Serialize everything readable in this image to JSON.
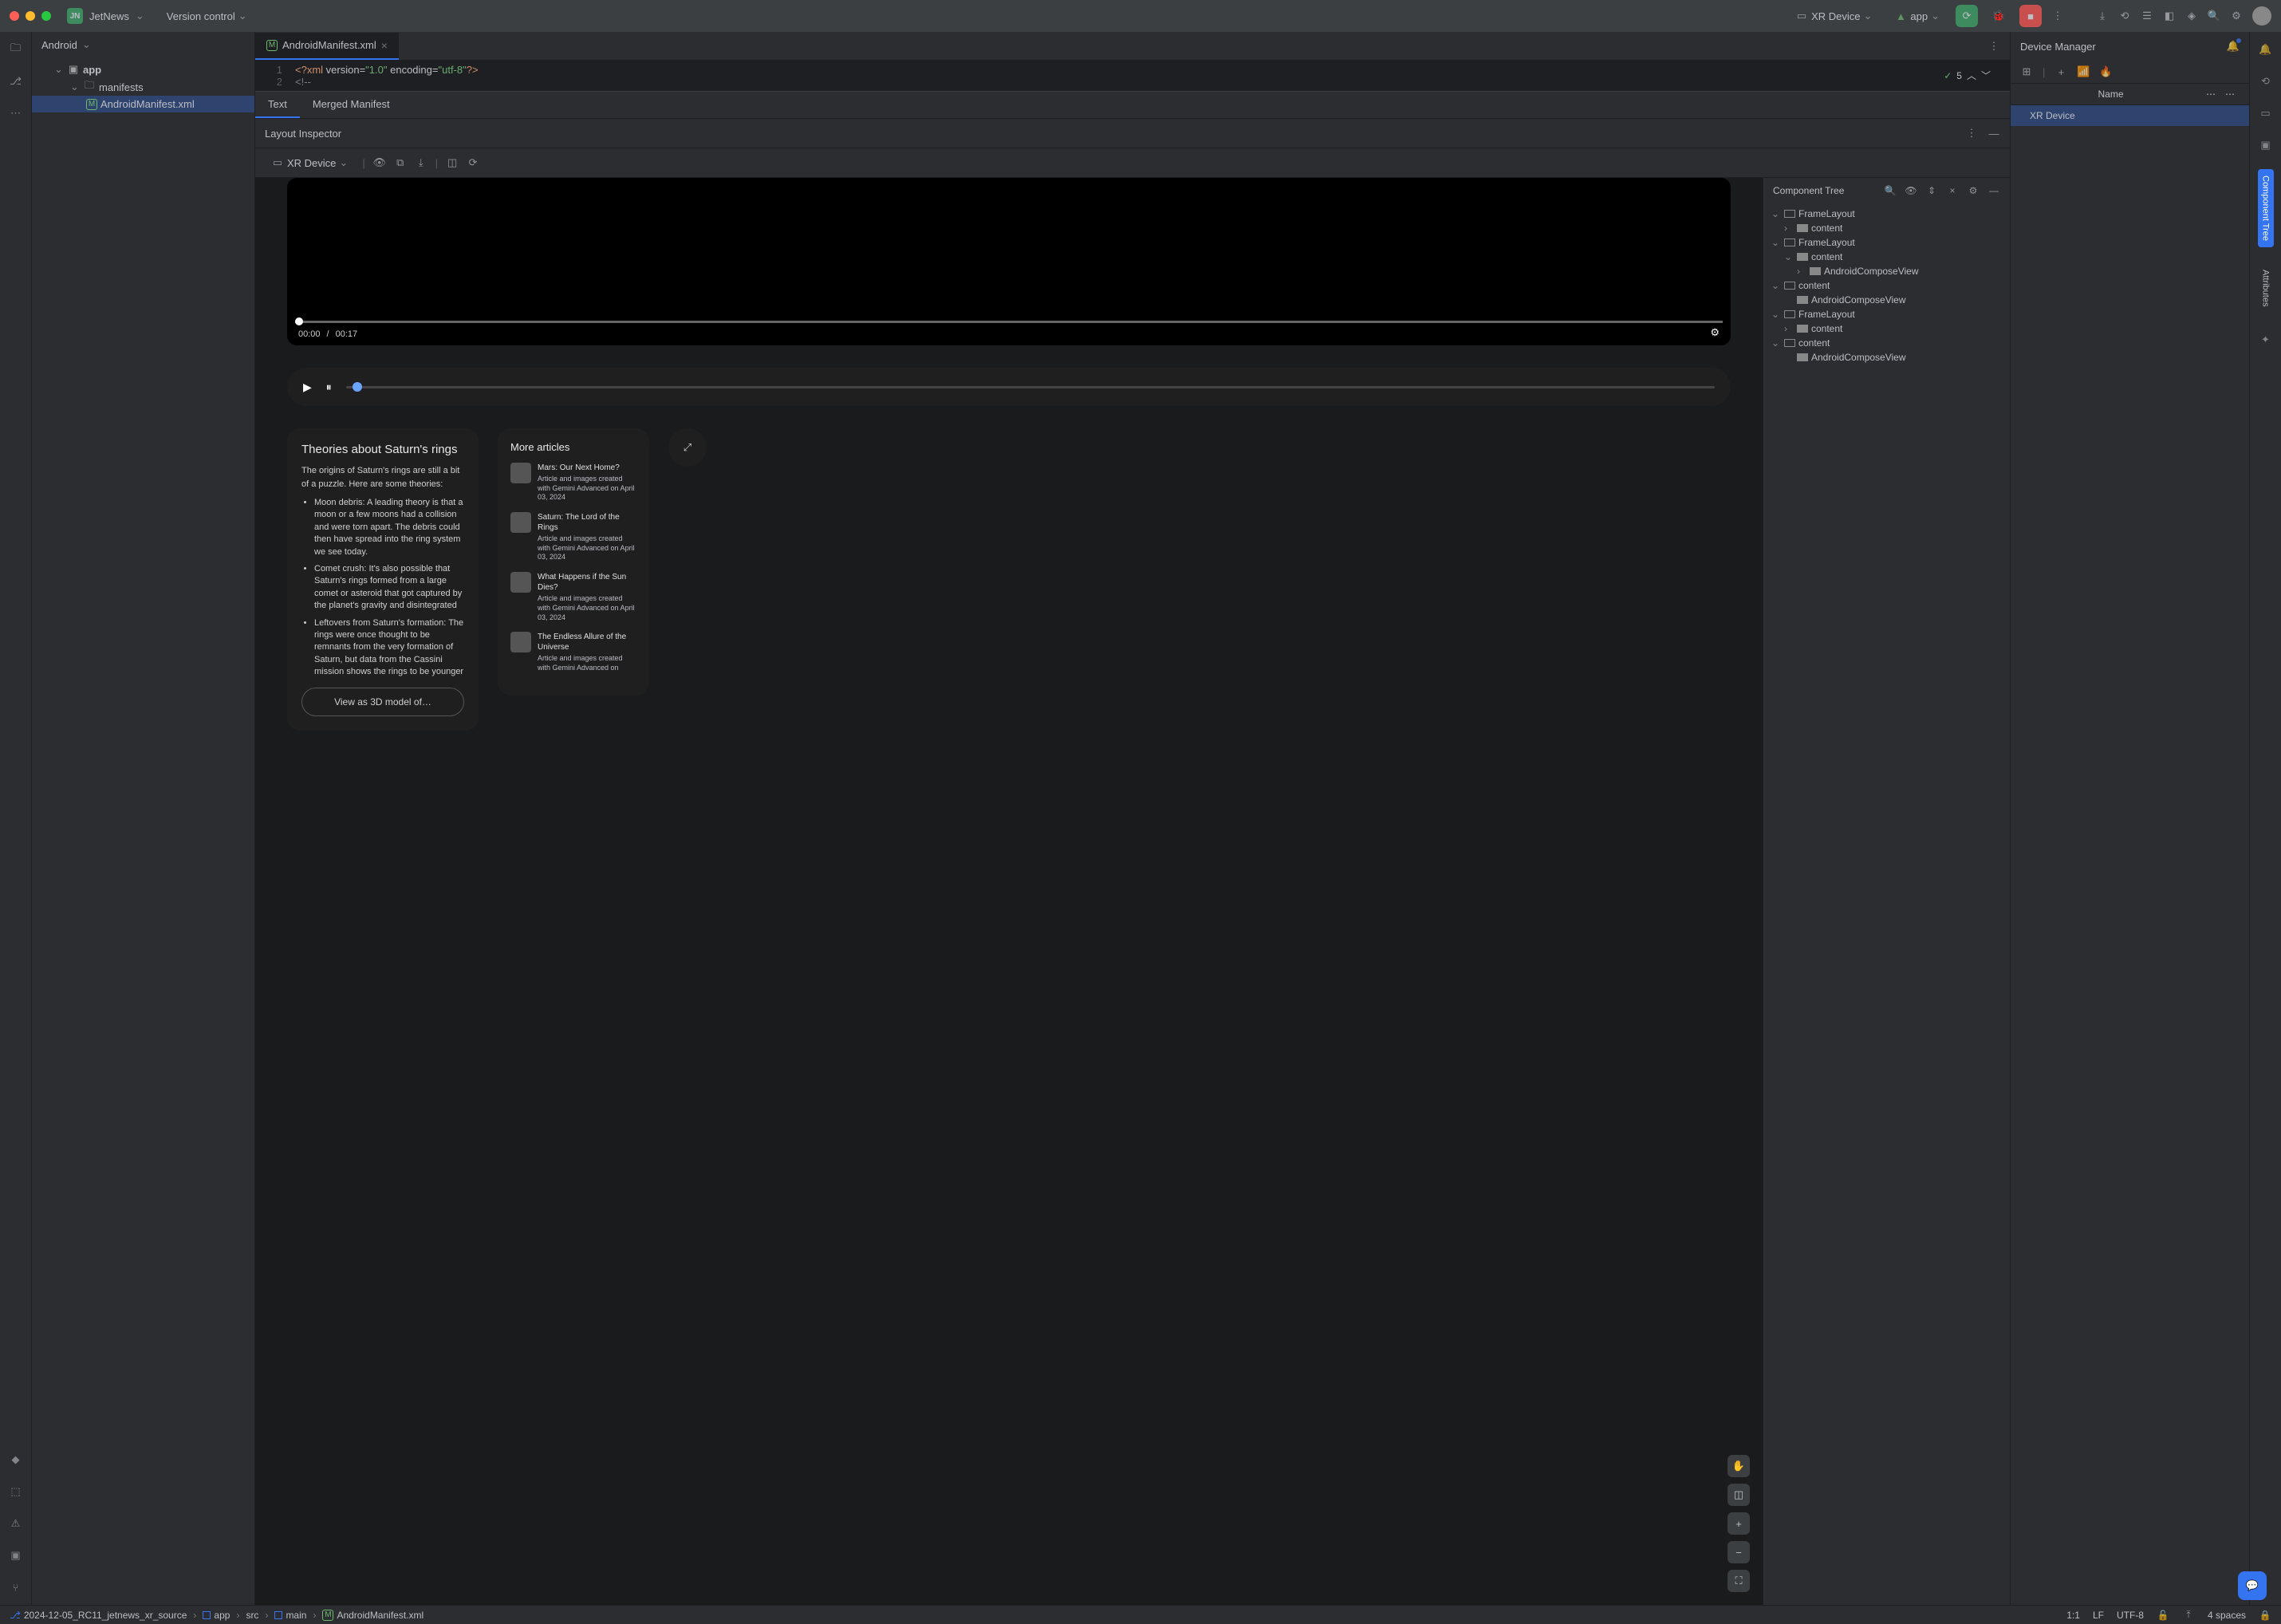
{
  "project": {
    "badge": "JN",
    "name": "JetNews"
  },
  "titlebar": {
    "vcs": "Version control",
    "deviceSelector": "XR Device",
    "runConfig": "app"
  },
  "projectPanel": {
    "title": "Android",
    "tree": {
      "app": "app",
      "manifests": "manifests",
      "manifestFile": "AndroidManifest.xml"
    }
  },
  "editor": {
    "tabFile": "AndroidManifest.xml",
    "line1": {
      "num": "1",
      "decl": "<?xml",
      "attr1": "version=",
      "val1": "\"1.0\"",
      "attr2": "encoding=",
      "val2": "\"utf-8\"",
      "close": "?>"
    },
    "line2": {
      "num": "2",
      "text": "<!--"
    },
    "problemsCount": "5",
    "subtabs": {
      "text": "Text",
      "merged": "Merged Manifest"
    }
  },
  "layoutInspector": {
    "title": "Layout Inspector",
    "deviceLabel": "XR Device"
  },
  "appContent": {
    "video": {
      "t0": "00:00",
      "sep": "/",
      "t1": "00:17"
    },
    "article": {
      "title": "Theories about Saturn's rings",
      "intro": "The origins of Saturn's rings are still a bit of a puzzle. Here are some theories:",
      "b1": "Moon debris: A leading theory is that a moon or a few moons had a collision and were torn apart. The debris could then have spread into the ring system we see today.",
      "b2": "Comet crush: It's also possible that Saturn's rings formed from a large comet or asteroid that got captured by the planet's gravity and disintegrated",
      "b3": "Leftovers from Saturn's formation: The rings were once thought to be remnants from the very formation of Saturn, but data from the Cassini mission shows the rings to be younger",
      "viewBtn": "View as 3D model of…"
    },
    "more": {
      "heading": "More articles",
      "items": [
        {
          "title": "Mars: Our Next Home?",
          "sub": "Article and images created with Gemini Advanced on April 03, 2024"
        },
        {
          "title": "Saturn: The Lord of the Rings",
          "sub": "Article and images created with Gemini Advanced on April 03, 2024"
        },
        {
          "title": "What Happens if the Sun Dies?",
          "sub": "Article and images created with Gemini Advanced on April 03, 2024"
        },
        {
          "title": "The Endless Allure of the Universe",
          "sub": "Article and images created with Gemini Advanced on"
        }
      ]
    }
  },
  "componentTree": {
    "title": "Component Tree",
    "items": [
      "FrameLayout",
      "content",
      "FrameLayout",
      "content",
      "AndroidComposeView",
      "content",
      "AndroidComposeView",
      "FrameLayout",
      "content",
      "content",
      "AndroidComposeView"
    ]
  },
  "deviceManager": {
    "title": "Device Manager",
    "colName": "Name",
    "device": "XR Device"
  },
  "rightGutter": {
    "compTree": "Component Tree",
    "attributes": "Attributes"
  },
  "breadcrumbs": {
    "branch": "2024-12-05_RC11_jetnews_xr_source",
    "p1": "app",
    "p2": "src",
    "p3": "main",
    "p4": "AndroidManifest.xml"
  },
  "statusbar": {
    "pos": "1:1",
    "le": "LF",
    "enc": "UTF-8",
    "indent": "4 spaces"
  }
}
